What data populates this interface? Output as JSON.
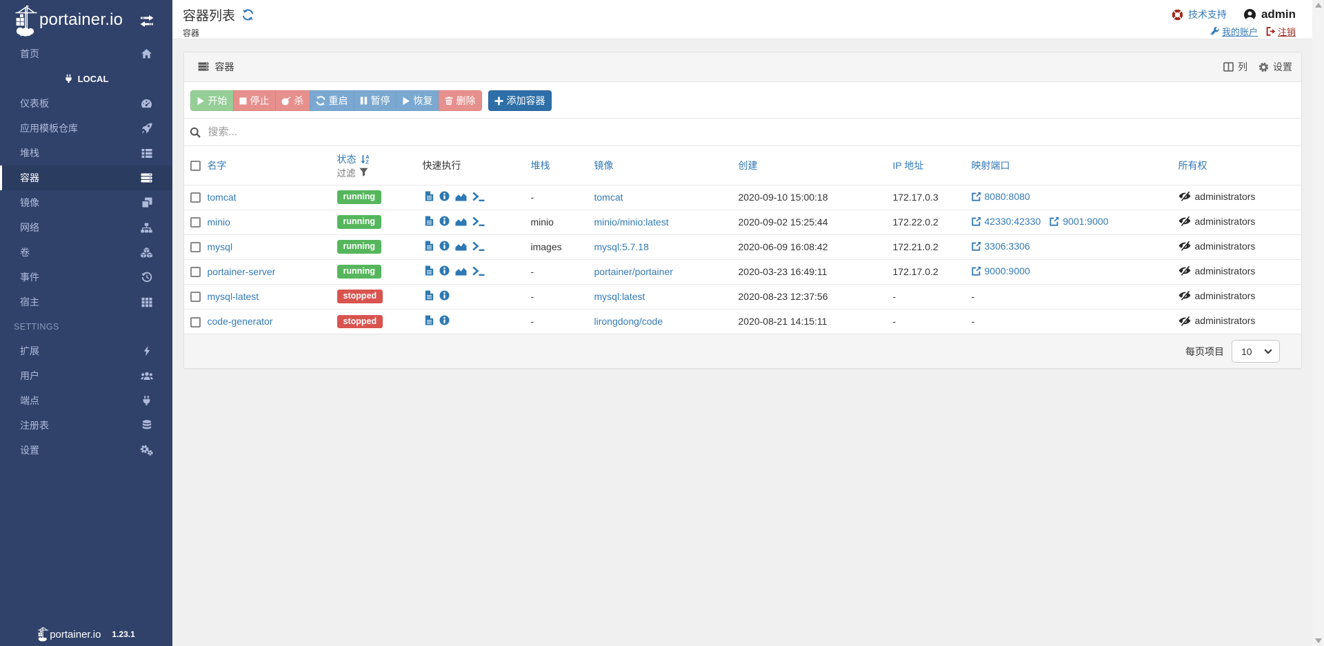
{
  "sidebar": {
    "brand": "portainer.io",
    "local_label": "LOCAL",
    "settings_label": "SETTINGS",
    "items": [
      {
        "label": "首页",
        "icon": "home-icon"
      },
      {
        "label": "仪表板",
        "icon": "tachometer-icon"
      },
      {
        "label": "应用模板仓库",
        "icon": "rocket-icon"
      },
      {
        "label": "堆栈",
        "icon": "th-list-icon"
      },
      {
        "label": "容器",
        "icon": "server-icon",
        "active": true
      },
      {
        "label": "镜像",
        "icon": "clone-icon"
      },
      {
        "label": "网络",
        "icon": "sitemap-icon"
      },
      {
        "label": "卷",
        "icon": "cubes-icon"
      },
      {
        "label": "事件",
        "icon": "history-icon"
      },
      {
        "label": "宿主",
        "icon": "th-icon"
      },
      {
        "label": "扩展",
        "icon": "bolt-icon"
      },
      {
        "label": "用户",
        "icon": "users-icon"
      },
      {
        "label": "端点",
        "icon": "plug-icon"
      },
      {
        "label": "注册表",
        "icon": "database-icon"
      },
      {
        "label": "设置",
        "icon": "cogs-icon"
      }
    ],
    "footer": {
      "brand": "portainer.io",
      "version": "1.23.1"
    }
  },
  "header": {
    "title": "容器列表",
    "breadcrumb": "容器",
    "support_label": "技术支持",
    "user": "admin",
    "account_label": "我的账户",
    "logout_label": "注销"
  },
  "panel": {
    "title": "容器",
    "columns_label": "列",
    "settings_label": "设置",
    "toolbar": {
      "start": "开始",
      "stop": "停止",
      "kill": "杀",
      "restart": "重启",
      "pause": "暂停",
      "resume": "恢复",
      "remove": "删除",
      "add": "添加容器"
    },
    "search_placeholder": "搜索...",
    "table": {
      "empty": "-",
      "headers": {
        "name": "名字",
        "state": "状态",
        "filter": "过滤",
        "quick": "快速执行",
        "stack": "堆栈",
        "image": "镜像",
        "created": "创建",
        "ip": "IP 地址",
        "ports": "映射端口",
        "ownership": "所有权"
      },
      "rows": [
        {
          "name": "tomcat",
          "status": "running",
          "stack": "-",
          "image": "tomcat",
          "created": "2020-09-10 15:00:18",
          "ip": "172.17.0.3",
          "ports": [
            "8080:8080"
          ],
          "ownership": "administrators"
        },
        {
          "name": "minio",
          "status": "running",
          "stack": "minio",
          "image": "minio/minio:latest",
          "created": "2020-09-02 15:25:44",
          "ip": "172.22.0.2",
          "ports": [
            "42330:42330",
            "9001:9000"
          ],
          "ownership": "administrators"
        },
        {
          "name": "mysql",
          "status": "running",
          "stack": "images",
          "image": "mysql:5.7.18",
          "created": "2020-06-09 16:08:42",
          "ip": "172.21.0.2",
          "ports": [
            "3306:3306"
          ],
          "ownership": "administrators"
        },
        {
          "name": "portainer-server",
          "status": "running",
          "stack": "-",
          "image": "portainer/portainer",
          "created": "2020-03-23 16:49:11",
          "ip": "172.17.0.2",
          "ports": [
            "9000:9000"
          ],
          "ownership": "administrators"
        },
        {
          "name": "mysql-latest",
          "status": "stopped",
          "stack": "-",
          "image": "mysql:latest",
          "created": "2020-08-23 12:37:56",
          "ip": "-",
          "ports": [],
          "ownership": "administrators"
        },
        {
          "name": "code-generator",
          "status": "stopped",
          "stack": "-",
          "image": "lirongdong/code",
          "created": "2020-08-21 14:15:11",
          "ip": "-",
          "ports": [],
          "ownership": "administrators"
        }
      ],
      "status_colors": {
        "running": "#56b65c",
        "stopped": "#d9534f"
      }
    },
    "pagination": {
      "label": "每页项目",
      "value": "10"
    }
  },
  "colors": {
    "sidebar": "#30426a",
    "link": "#337ab7",
    "accent_red": "#9e2b20"
  }
}
